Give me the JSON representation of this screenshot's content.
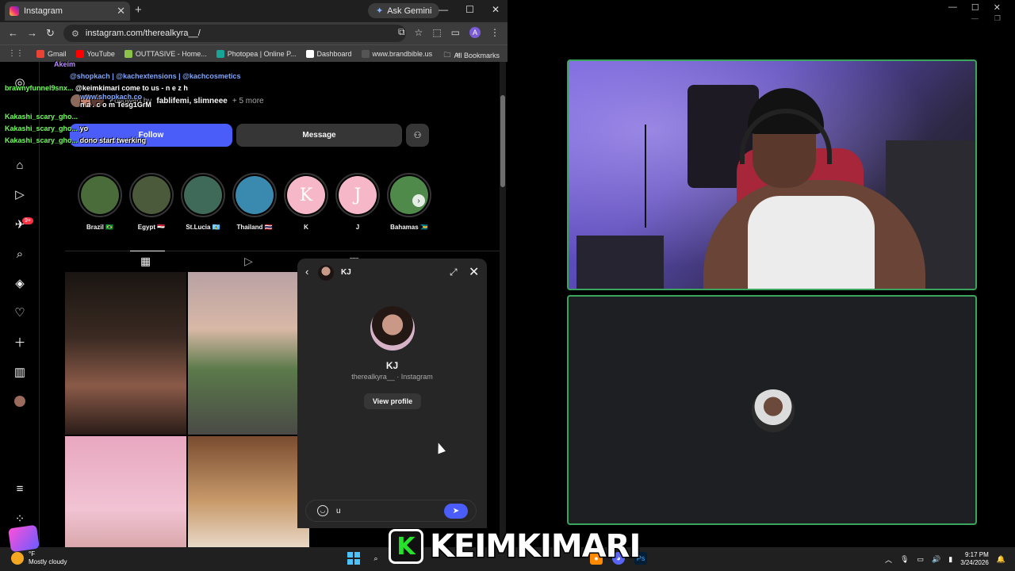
{
  "browser": {
    "tab_title": "Instagram",
    "gemini_label": "Ask Gemini",
    "url": "instagram.com/therealkyra__/",
    "profile_initial": "A",
    "bookmarks": [
      {
        "label": "Gmail",
        "color": "#ea4335"
      },
      {
        "label": "YouTube",
        "color": "#ff0000"
      },
      {
        "label": "OUTTASIVE - Home...",
        "color": "#8bc34a"
      },
      {
        "label": "Photopea | Online P...",
        "color": "#18a497"
      },
      {
        "label": "Dashboard",
        "color": "#ffffff"
      },
      {
        "label": "www.brandbible.us",
        "color": "#555555"
      }
    ],
    "all_bookmarks": "All Bookmarks"
  },
  "instagram": {
    "notification_count": "9+",
    "followed_by_prefix": "Followed by ",
    "followed_by_names": "fablifemi, slimneee",
    "followed_by_more": " + 5 more",
    "follow_label": "Follow",
    "message_label": "Message",
    "highlights": [
      {
        "label": "Brazil 🇧🇷",
        "letter": "",
        "color": "#4a6b3a"
      },
      {
        "label": "Egypt 🇪🇬",
        "letter": "",
        "color": "#4a5a3a"
      },
      {
        "label": "St.Lucia 🇱🇨",
        "letter": "",
        "color": "#3f6a5a"
      },
      {
        "label": "Thailand 🇹🇭",
        "letter": "",
        "color": "#3a8ab0"
      },
      {
        "label": "K",
        "letter": "K",
        "color": "#f6b8c8"
      },
      {
        "label": "J",
        "letter": "J",
        "color": "#f6b8c8"
      },
      {
        "label": "Bahamas 🇧🇸",
        "letter": "",
        "color": "#4f8a4a"
      }
    ]
  },
  "chat": [
    {
      "user": "Akeim",
      "text": "",
      "link": "@shopkach | @kachextensions | @kachcosmetics",
      "style": "purple"
    },
    {
      "user": "brawnyfunnel9snx...",
      "text": "@keimkimari come to us - n e z h",
      "link": "www.shopkach.co",
      "style": "green"
    },
    {
      "user": "",
      "text": "n a . c o m Tesg1GrM",
      "link": "",
      "style": "green"
    },
    {
      "user": "Kakashi_scary_gho...",
      "text": "",
      "link": "",
      "style": "green"
    },
    {
      "user": "Kakashi_scary_gho...",
      "text": "yo",
      "link": "",
      "style": "green"
    },
    {
      "user": "Kakashi_scary_gho...",
      "text": "dono start twerking",
      "link": "",
      "style": "green"
    }
  ],
  "dm": {
    "header_name": "KJ",
    "name": "KJ",
    "subtitle": "therealkyra__ · Instagram",
    "view_profile": "View profile",
    "input_value": "u"
  },
  "banner": {
    "logo_letter": "K",
    "name": "KEIMKIMARI"
  },
  "taskbar": {
    "temperature": "°F",
    "weather": "Mostly cloudy",
    "time": "9:17 PM",
    "date": "3/24/2026"
  },
  "colors": {
    "instagram_blue": "#4a5df9",
    "speaking_border": "#3ba55d",
    "chat_green": "#6cff58"
  }
}
